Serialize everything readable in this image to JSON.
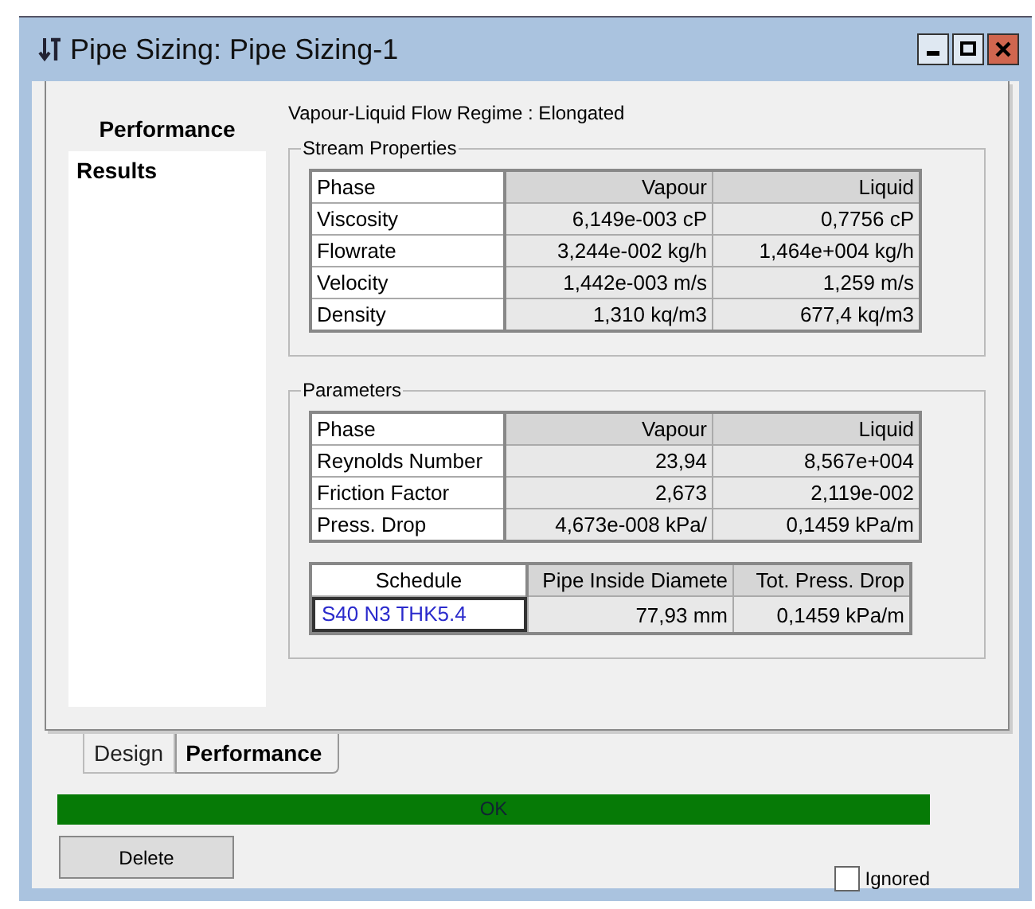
{
  "window": {
    "title": "Pipe Sizing: Pipe Sizing-1"
  },
  "navigator": {
    "heading": "Performance",
    "items": [
      {
        "label": "Results",
        "selected": true
      }
    ]
  },
  "flow_regime": "Vapour-Liquid Flow Regime : Elongated",
  "stream_properties": {
    "title": "Stream Properties",
    "columns": [
      "Phase",
      "Vapour",
      "Liquid"
    ],
    "rows": [
      [
        "Viscosity",
        "6,149e-003 cP",
        "0,7756 cP"
      ],
      [
        "Flowrate",
        "3,244e-002 kg/h",
        "1,464e+004 kg/h"
      ],
      [
        "Velocity",
        "1,442e-003 m/s",
        "1,259 m/s"
      ],
      [
        "Density",
        "1,310 kq/m3",
        "677,4 kq/m3"
      ]
    ]
  },
  "parameters": {
    "title": "Parameters",
    "columns": [
      "Phase",
      "Vapour",
      "Liquid"
    ],
    "rows": [
      [
        "Reynolds Number",
        "23,94",
        "8,567e+004"
      ],
      [
        "Friction Factor",
        "2,673",
        "2,119e-002"
      ],
      [
        "Press. Drop",
        "4,673e-008 kPa/",
        "0,1459 kPa/m"
      ]
    ],
    "schedule_table": {
      "columns": [
        "Schedule",
        "Pipe Inside Diamete",
        "Tot. Press. Drop"
      ],
      "rows": [
        {
          "schedule": "S40 N3 THK5.4",
          "diameter": "77,93 mm",
          "pressure_drop": "0,1459 kPa/m"
        }
      ]
    }
  },
  "tabs": [
    {
      "label": "Design",
      "selected": false
    },
    {
      "label": "Performance",
      "selected": true
    }
  ],
  "status": {
    "text": "OK"
  },
  "buttons": [
    "Delete"
  ],
  "ignored": {
    "label": "Ignored",
    "checked": false
  }
}
